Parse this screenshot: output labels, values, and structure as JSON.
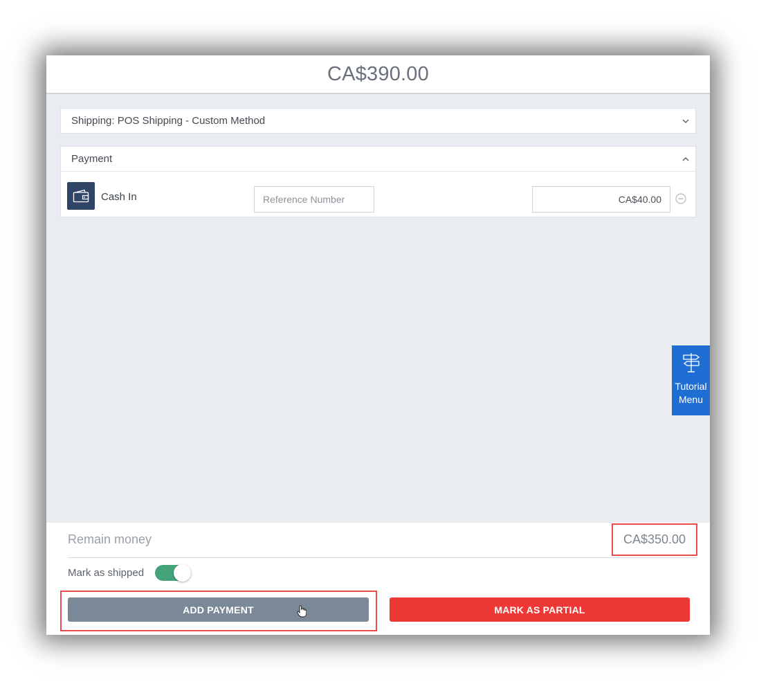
{
  "header": {
    "total": "CA$390.00"
  },
  "shipping": {
    "label": "Shipping: POS Shipping - Custom Method",
    "icon": "chevron-down-icon"
  },
  "payment": {
    "title": "Payment",
    "icon": "chevron-up-icon",
    "method": {
      "label": "Cash In",
      "icon": "wallet-icon",
      "reference_placeholder": "Reference Number",
      "amount": "CA$40.00",
      "remove_icon": "minus-circle-icon"
    }
  },
  "tutorial": {
    "line1": "Tutorial",
    "line2": "Menu",
    "icon": "signpost-icon"
  },
  "footer": {
    "remain_label": "Remain money",
    "remain_value": "CA$350.00",
    "ship_label": "Mark as shipped",
    "shipped": true,
    "add_payment": "ADD PAYMENT",
    "mark_partial": "MARK AS PARTIAL"
  },
  "colors": {
    "accent_blue": "#1f6ed4",
    "danger_red": "#ee3836",
    "toggle_green": "#45a37a",
    "wallet_navy": "#2f4466",
    "highlight": "#e94b4b"
  }
}
